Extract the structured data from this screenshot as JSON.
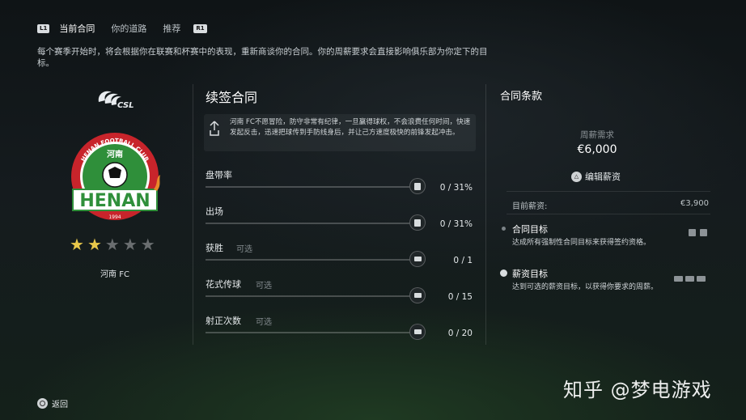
{
  "tabs": {
    "l1": "L1",
    "r1": "R1",
    "items": [
      {
        "label": "当前合同",
        "active": true
      },
      {
        "label": "你的道路",
        "active": false
      },
      {
        "label": "推荐",
        "active": false
      }
    ]
  },
  "intro": "每个赛季开始时，将会根据你在联赛和杯赛中的表现，重新商谈你的合同。你的周薪要求会直接影响俱乐部为你定下的目标。",
  "league_logo_text": "CSL",
  "club": {
    "name": "河南 FC",
    "crest_text": "HENAN",
    "crest_ring_text": "HENAN FOOTBALL CLUB",
    "crest_cn": "河南",
    "crest_year": "1994",
    "stars": 2,
    "max_stars": 5
  },
  "renewal": {
    "title": "续签合同",
    "description": "河南 FC不愿冒险，防守非常有纪律，一旦赢得球权，不会浪费任何时间，快速发起反击，迅速把球传到手防线身后，并让己方速度极快的前锋发起冲击。",
    "objectives": [
      {
        "label": "盘带率",
        "optional": "",
        "value": "0 / 31%",
        "icon": "document-icon"
      },
      {
        "label": "出场",
        "optional": "",
        "value": "0 / 31%",
        "icon": "document-icon"
      },
      {
        "label": "获胜",
        "optional": "可选",
        "value": "0 / 1",
        "icon": "money-icon"
      },
      {
        "label": "花式传球",
        "optional": "可选",
        "value": "0 / 15",
        "icon": "money-icon"
      },
      {
        "label": "射正次数",
        "optional": "可选",
        "value": "0 / 20",
        "icon": "money-icon"
      }
    ]
  },
  "terms": {
    "title": "合同条款",
    "wage_label": "周薪需求",
    "wage_value": "€6,000",
    "edit_label": "编辑薪资",
    "current_label": "目前薪资:",
    "current_value": "€3,900",
    "contract_goal_title": "合同目标",
    "contract_goal_desc": "达成所有强制性合同目标来获得签约资格。",
    "salary_goal_title": "薪资目标",
    "salary_goal_desc": "达到可选的薪资目标，以获得你要求的周薪。"
  },
  "footer": {
    "back_label": "返回"
  },
  "watermark": "知乎 @梦电游戏",
  "colors": {
    "star_on": "#e9c84a",
    "crest_red": "#c8242b",
    "crest_green": "#2f8f3a"
  }
}
